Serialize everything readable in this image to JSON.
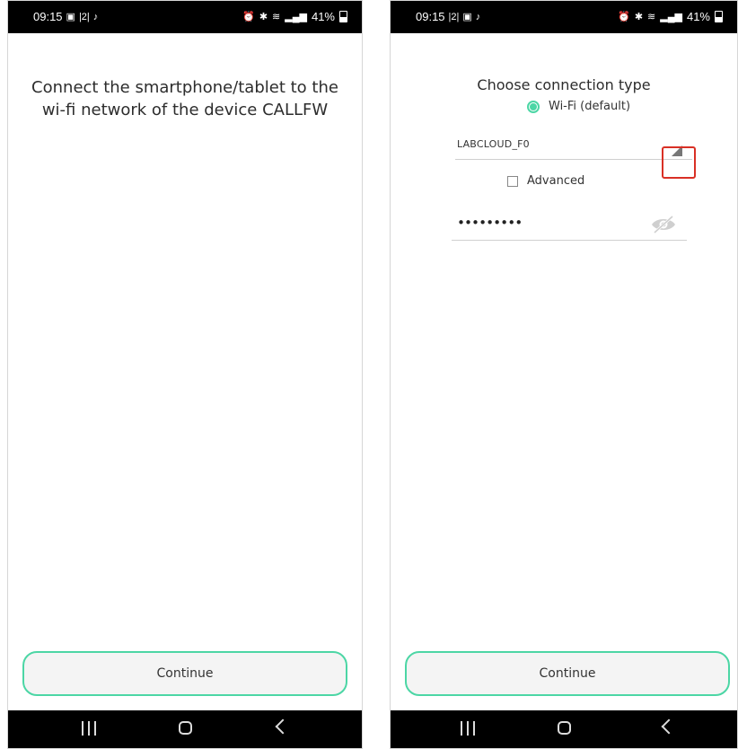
{
  "status_bar": {
    "left": {
      "time": "09:15"
    },
    "right": {
      "time": "09:15"
    },
    "battery": "41%",
    "icons_left": [
      "gallery-icon",
      "sim-2-icon",
      "tiktok-icon"
    ],
    "icons_right": [
      "alarm-icon",
      "bluetooth-icon",
      "wifi-icon",
      "signal-icon",
      "battery-icon"
    ]
  },
  "left_screen": {
    "message": "Connect the smartphone/tablet to the wi-fi network of the device CALLFW",
    "continue_label": "Continue"
  },
  "right_screen": {
    "title": "Choose connection type",
    "radio_option": "Wi-Fi (default)",
    "ssid": "LABCLOUD_F0",
    "advanced_label": "Advanced",
    "password_masked": "•••••••••",
    "continue_label": "Continue"
  },
  "colors": {
    "accent": "#4cd6a5",
    "highlight": "#d93025",
    "statusbar_bg": "#000000"
  }
}
